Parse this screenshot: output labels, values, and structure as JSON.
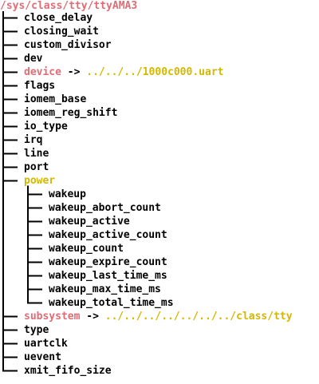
{
  "root_path": "/sys/class/tty/ttyAMA3",
  "arrow": "->",
  "entries": [
    {
      "name": "close_delay",
      "kind": "file"
    },
    {
      "name": "closing_wait",
      "kind": "file"
    },
    {
      "name": "custom_divisor",
      "kind": "file"
    },
    {
      "name": "dev",
      "kind": "file"
    },
    {
      "name": "device",
      "kind": "symlink",
      "target": "../../../1000c000.uart"
    },
    {
      "name": "flags",
      "kind": "file"
    },
    {
      "name": "iomem_base",
      "kind": "file"
    },
    {
      "name": "iomem_reg_shift",
      "kind": "file"
    },
    {
      "name": "io_type",
      "kind": "file"
    },
    {
      "name": "irq",
      "kind": "file"
    },
    {
      "name": "line",
      "kind": "file"
    },
    {
      "name": "port",
      "kind": "file"
    },
    {
      "name": "power",
      "kind": "dir",
      "children": [
        "wakeup",
        "wakeup_abort_count",
        "wakeup_active",
        "wakeup_active_count",
        "wakeup_count",
        "wakeup_expire_count",
        "wakeup_last_time_ms",
        "wakeup_max_time_ms",
        "wakeup_total_time_ms"
      ]
    },
    {
      "name": "subsystem",
      "kind": "symlink",
      "target": "../../../../../../../class/tty"
    },
    {
      "name": "type",
      "kind": "file"
    },
    {
      "name": "uartclk",
      "kind": "file"
    },
    {
      "name": "uevent",
      "kind": "file"
    },
    {
      "name": "xmit_fifo_size",
      "kind": "file"
    }
  ],
  "colors": {
    "root": "#e06c75",
    "symlink": "#e06c75",
    "dir": "#d4b800",
    "link_target": "#d4b800",
    "file": "#000000"
  }
}
